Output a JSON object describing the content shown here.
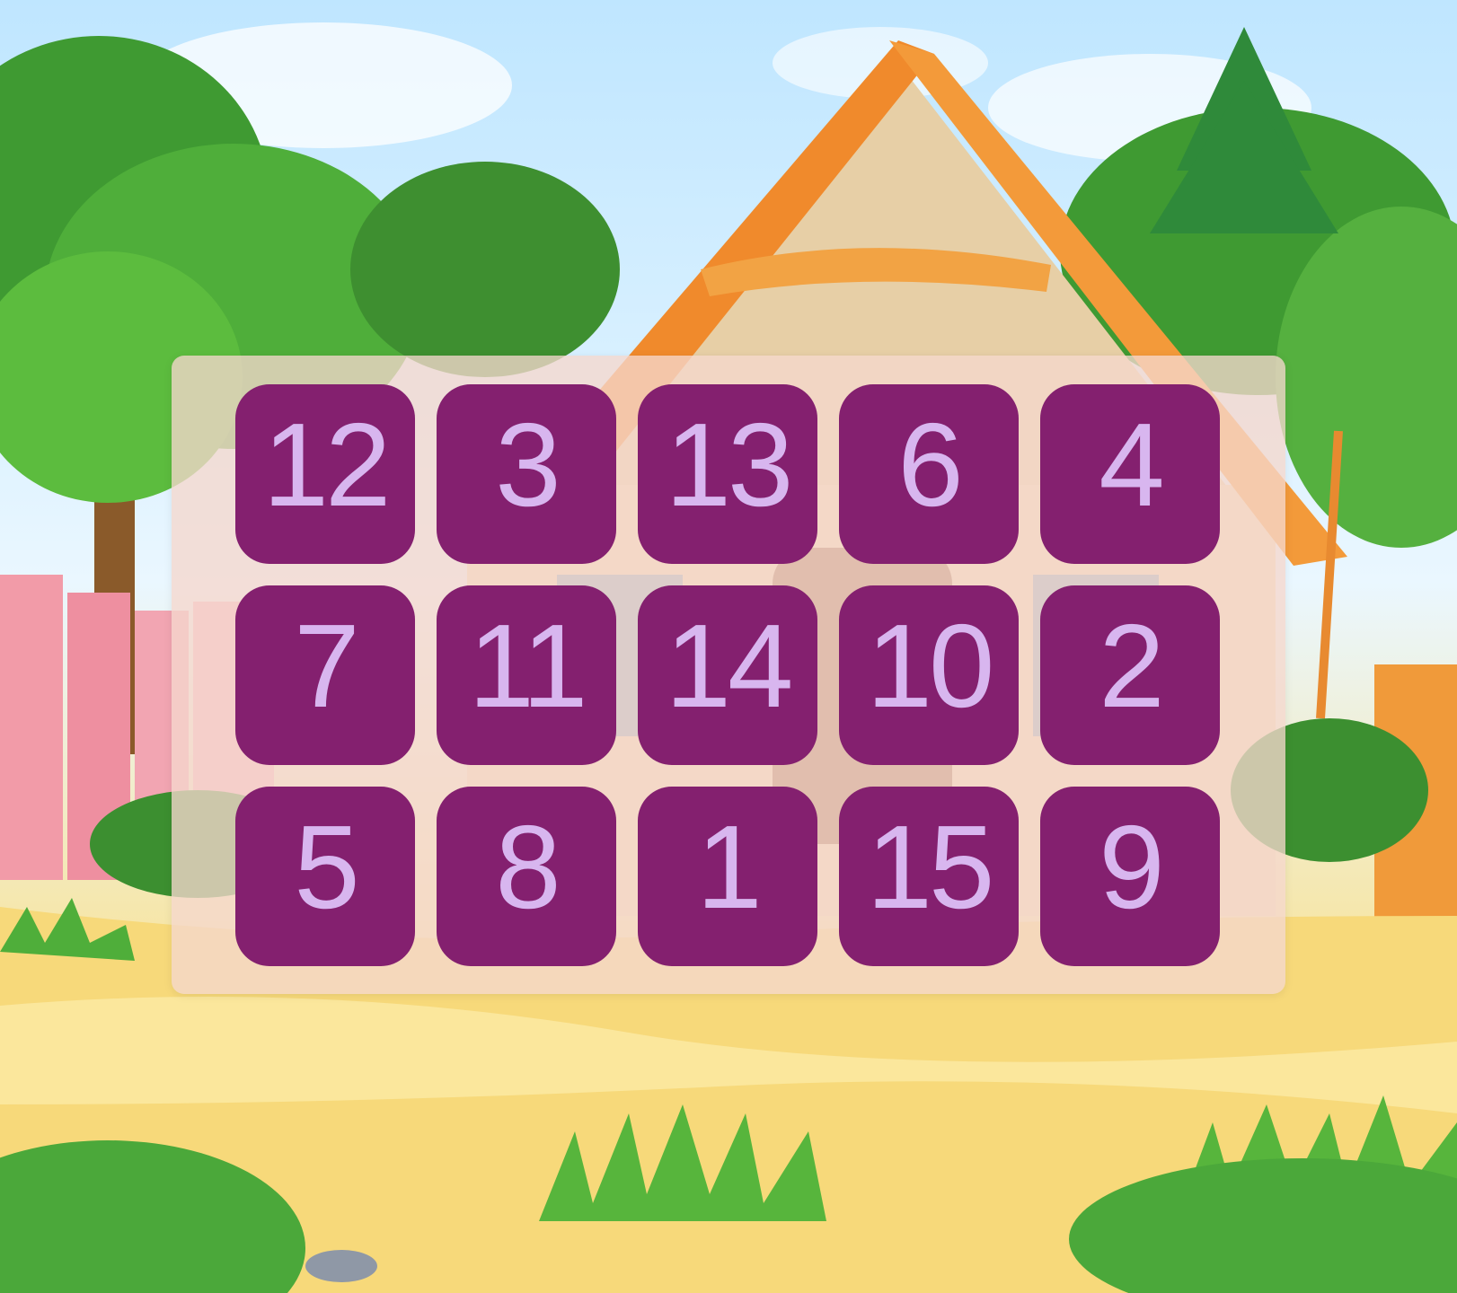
{
  "colors": {
    "tile_background": "#84206f",
    "tile_text": "#d8b6ef",
    "board_overlay": "#f5d7cd"
  },
  "board": {
    "rows": 3,
    "columns": 5,
    "tiles": [
      [
        "12",
        "3",
        "13",
        "6",
        "4"
      ],
      [
        "7",
        "11",
        "14",
        "10",
        "2"
      ],
      [
        "5",
        "8",
        "1",
        "15",
        "9"
      ]
    ]
  }
}
